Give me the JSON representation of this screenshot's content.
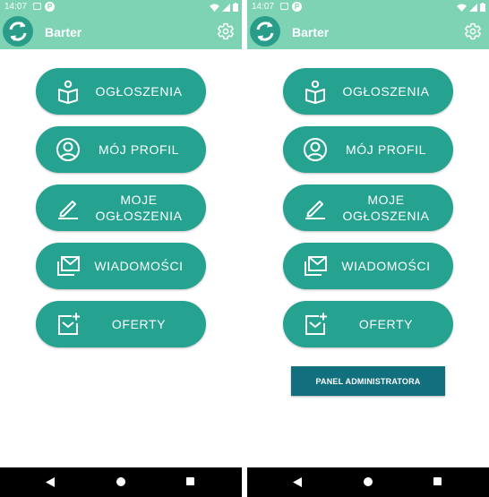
{
  "colors": {
    "app_bar": "#7ed3b5",
    "button": "#26a291",
    "admin_button": "#116f7e",
    "nav_bar": "#000000"
  },
  "screens": [
    {
      "status": {
        "time": "14:07",
        "notify_p": "P"
      },
      "app": {
        "title": "Barter"
      },
      "menu": [
        {
          "label": "OGŁOSZENIA",
          "icon": "reading-book-icon"
        },
        {
          "label": "MÓJ PROFIL",
          "icon": "user-circle-icon"
        },
        {
          "label": "MOJE OGŁOSZENIA",
          "icon": "edit-pencil-icon"
        },
        {
          "label": "WIADOMOŚCI",
          "icon": "messages-icon"
        },
        {
          "label": "OFERTY",
          "icon": "add-offer-icon"
        }
      ]
    },
    {
      "status": {
        "time": "14:07",
        "notify_p": "P"
      },
      "app": {
        "title": "Barter"
      },
      "menu": [
        {
          "label": "OGŁOSZENIA",
          "icon": "reading-book-icon"
        },
        {
          "label": "MÓJ PROFIL",
          "icon": "user-circle-icon"
        },
        {
          "label": "MOJE OGŁOSZENIA",
          "icon": "edit-pencil-icon"
        },
        {
          "label": "WIADOMOŚCI",
          "icon": "messages-icon"
        },
        {
          "label": "OFERTY",
          "icon": "add-offer-icon"
        }
      ],
      "admin_button": "PANEL ADMINISTRATORA"
    }
  ]
}
